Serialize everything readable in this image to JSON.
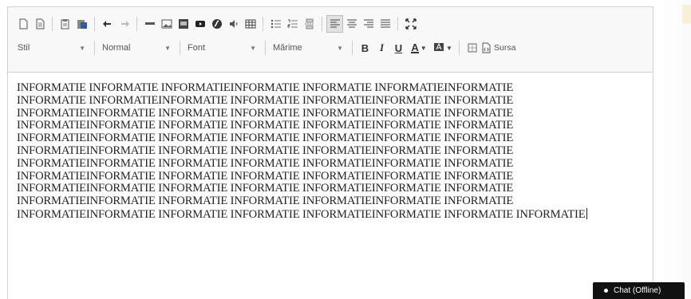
{
  "toolbar": {
    "row2": {
      "styles_combo": "Stil",
      "format_combo": "Normal",
      "font_combo": "Font",
      "size_combo": "Mărime",
      "bold": "B",
      "italic": "I",
      "underline": "U",
      "text_color": "A",
      "source_label": "Sursa"
    }
  },
  "content": {
    "lines": [
      "INFORMATIE INFORMATIE INFORMATIEINFORMATIE INFORMATIE INFORMATIEINFORMATIE",
      "INFORMATIE INFORMATIEINFORMATIE INFORMATIE INFORMATIEINFORMATIE INFORMATIE",
      "INFORMATIEINFORMATIE INFORMATIE INFORMATIE INFORMATIEINFORMATIE INFORMATIE",
      "INFORMATIEINFORMATIE INFORMATIE INFORMATIE INFORMATIEINFORMATIE INFORMATIE",
      "INFORMATIEINFORMATIE INFORMATIE INFORMATIE INFORMATIEINFORMATIE INFORMATIE",
      "INFORMATIEINFORMATIE INFORMATIE INFORMATIE INFORMATIEINFORMATIE INFORMATIE",
      "INFORMATIEINFORMATIE INFORMATIE INFORMATIE INFORMATIEINFORMATIE INFORMATIE",
      "INFORMATIEINFORMATIE INFORMATIE INFORMATIE INFORMATIEINFORMATIE INFORMATIE",
      "INFORMATIEINFORMATIE INFORMATIE INFORMATIE INFORMATIEINFORMATIE INFORMATIE",
      "INFORMATIEINFORMATIE INFORMATIE INFORMATIE INFORMATIEINFORMATIE INFORMATIE",
      "INFORMATIEINFORMATIE INFORMATIE INFORMATIE INFORMATIEINFORMATIE INFORMATIE INFORMATIE"
    ]
  },
  "chat": {
    "label": "Chat (Offline)"
  },
  "colors": {
    "toolbar_bg": "#f8f8f8",
    "border": "#d1d1d1",
    "chat_bg": "#111111"
  }
}
